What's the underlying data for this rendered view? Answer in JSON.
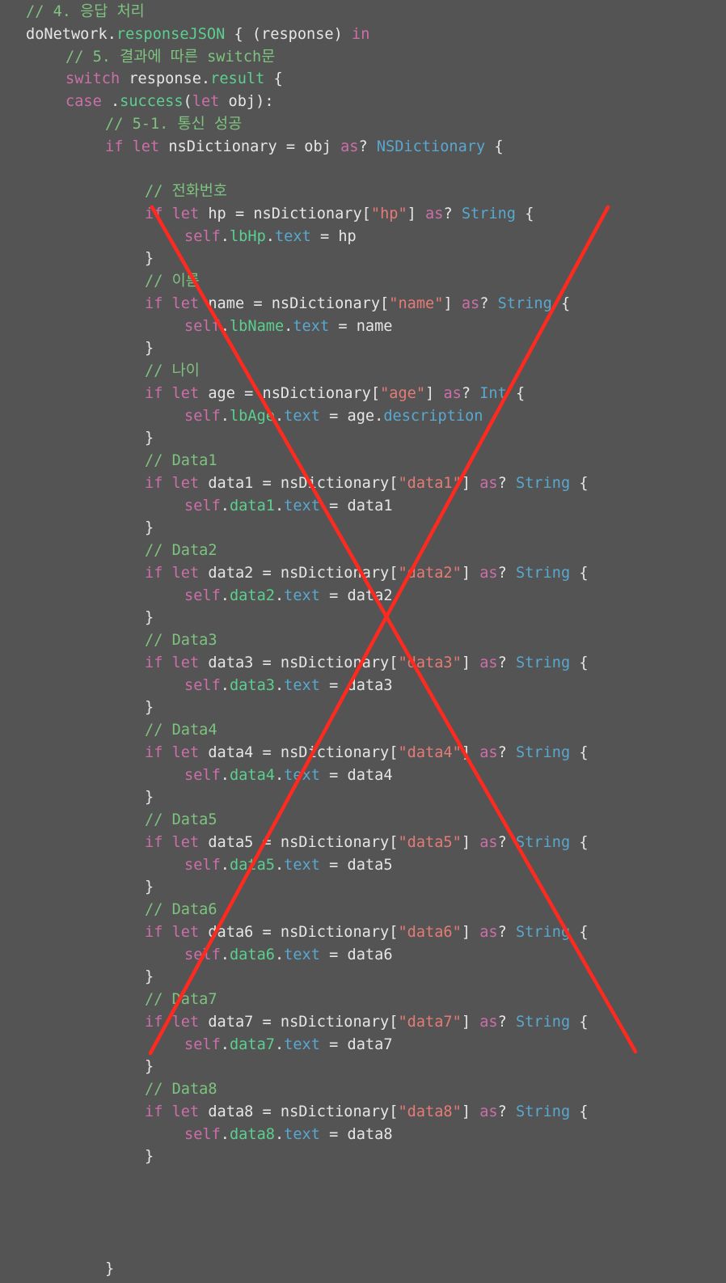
{
  "theme": {
    "background": "#545454",
    "plain": "#e6e6e6",
    "comment": "#7ec37f",
    "keyword": "#cc6fa9",
    "string": "#e57b76",
    "type": "#58a8d0",
    "member": "#5ccf8f",
    "property": "#58a8d0",
    "cross": "#ff2a1f"
  },
  "code": {
    "lines": [
      {
        "i": 0,
        "t": [
          [
            "comment",
            "// 4. 응답 처리"
          ]
        ]
      },
      {
        "i": 0,
        "t": [
          [
            "plain",
            "doNetwork."
          ],
          [
            "member",
            "responseJSON"
          ],
          [
            "plain",
            " { (response) "
          ],
          [
            "keyword",
            "in"
          ]
        ]
      },
      {
        "i": 1,
        "t": [
          [
            "comment",
            "// 5. 결과에 따른 switch문"
          ]
        ]
      },
      {
        "i": 1,
        "t": [
          [
            "keyword",
            "switch"
          ],
          [
            "plain",
            " response."
          ],
          [
            "member",
            "result"
          ],
          [
            "plain",
            " {"
          ]
        ]
      },
      {
        "i": 1,
        "t": [
          [
            "keyword",
            "case"
          ],
          [
            "plain",
            " ."
          ],
          [
            "member",
            "success"
          ],
          [
            "plain",
            "("
          ],
          [
            "keyword",
            "let"
          ],
          [
            "plain",
            " obj):"
          ]
        ]
      },
      {
        "i": 2,
        "t": [
          [
            "comment",
            "// 5-1. 통신 성공"
          ]
        ]
      },
      {
        "i": 2,
        "t": [
          [
            "keyword",
            "if let"
          ],
          [
            "plain",
            " nsDictionary = obj "
          ],
          [
            "keyword",
            "as"
          ],
          [
            "plain",
            "? "
          ],
          [
            "type",
            "NSDictionary"
          ],
          [
            "plain",
            " {"
          ]
        ]
      },
      {
        "i": 0,
        "t": []
      },
      {
        "i": 3,
        "t": [
          [
            "comment",
            "// 전화번호"
          ]
        ]
      },
      {
        "i": 3,
        "t": [
          [
            "keyword",
            "if let"
          ],
          [
            "plain",
            " hp = nsDictionary["
          ],
          [
            "string",
            "\"hp\""
          ],
          [
            "plain",
            "] "
          ],
          [
            "keyword",
            "as"
          ],
          [
            "plain",
            "? "
          ],
          [
            "type",
            "String"
          ],
          [
            "plain",
            " {"
          ]
        ]
      },
      {
        "i": 4,
        "t": [
          [
            "keyword",
            "self"
          ],
          [
            "plain",
            "."
          ],
          [
            "member",
            "lbHp"
          ],
          [
            "plain",
            "."
          ],
          [
            "prop",
            "text"
          ],
          [
            "plain",
            " = hp"
          ]
        ]
      },
      {
        "i": 3,
        "t": [
          [
            "plain",
            "}"
          ]
        ]
      },
      {
        "i": 3,
        "t": [
          [
            "comment",
            "// 이름"
          ]
        ]
      },
      {
        "i": 3,
        "t": [
          [
            "keyword",
            "if let"
          ],
          [
            "plain",
            " name = nsDictionary["
          ],
          [
            "string",
            "\"name\""
          ],
          [
            "plain",
            "] "
          ],
          [
            "keyword",
            "as"
          ],
          [
            "plain",
            "? "
          ],
          [
            "type",
            "String"
          ],
          [
            "plain",
            " {"
          ]
        ]
      },
      {
        "i": 4,
        "t": [
          [
            "keyword",
            "self"
          ],
          [
            "plain",
            "."
          ],
          [
            "member",
            "lbName"
          ],
          [
            "plain",
            "."
          ],
          [
            "prop",
            "text"
          ],
          [
            "plain",
            " = name"
          ]
        ]
      },
      {
        "i": 3,
        "t": [
          [
            "plain",
            "}"
          ]
        ]
      },
      {
        "i": 3,
        "t": [
          [
            "comment",
            "// 나이"
          ]
        ]
      },
      {
        "i": 3,
        "t": [
          [
            "keyword",
            "if let"
          ],
          [
            "plain",
            " age = nsDictionary["
          ],
          [
            "string",
            "\"age\""
          ],
          [
            "plain",
            "] "
          ],
          [
            "keyword",
            "as"
          ],
          [
            "plain",
            "? "
          ],
          [
            "type",
            "Int"
          ],
          [
            "plain",
            " {"
          ]
        ]
      },
      {
        "i": 4,
        "t": [
          [
            "keyword",
            "self"
          ],
          [
            "plain",
            "."
          ],
          [
            "member",
            "lbAge"
          ],
          [
            "plain",
            "."
          ],
          [
            "prop",
            "text"
          ],
          [
            "plain",
            " = age."
          ],
          [
            "prop",
            "description"
          ]
        ]
      },
      {
        "i": 3,
        "t": [
          [
            "plain",
            "}"
          ]
        ]
      },
      {
        "i": 3,
        "t": [
          [
            "comment",
            "// Data1"
          ]
        ]
      },
      {
        "i": 3,
        "t": [
          [
            "keyword",
            "if let"
          ],
          [
            "plain",
            " data1 = nsDictionary["
          ],
          [
            "string",
            "\"data1\""
          ],
          [
            "plain",
            "] "
          ],
          [
            "keyword",
            "as"
          ],
          [
            "plain",
            "? "
          ],
          [
            "type",
            "String"
          ],
          [
            "plain",
            " {"
          ]
        ]
      },
      {
        "i": 4,
        "t": [
          [
            "keyword",
            "self"
          ],
          [
            "plain",
            "."
          ],
          [
            "member",
            "data1"
          ],
          [
            "plain",
            "."
          ],
          [
            "prop",
            "text"
          ],
          [
            "plain",
            " = data1"
          ]
        ]
      },
      {
        "i": 3,
        "t": [
          [
            "plain",
            "}"
          ]
        ]
      },
      {
        "i": 3,
        "t": [
          [
            "comment",
            "// Data2"
          ]
        ]
      },
      {
        "i": 3,
        "t": [
          [
            "keyword",
            "if let"
          ],
          [
            "plain",
            " data2 = nsDictionary["
          ],
          [
            "string",
            "\"data2\""
          ],
          [
            "plain",
            "] "
          ],
          [
            "keyword",
            "as"
          ],
          [
            "plain",
            "? "
          ],
          [
            "type",
            "String"
          ],
          [
            "plain",
            " {"
          ]
        ]
      },
      {
        "i": 4,
        "t": [
          [
            "keyword",
            "self"
          ],
          [
            "plain",
            "."
          ],
          [
            "member",
            "data2"
          ],
          [
            "plain",
            "."
          ],
          [
            "prop",
            "text"
          ],
          [
            "plain",
            " = data2"
          ]
        ]
      },
      {
        "i": 3,
        "t": [
          [
            "plain",
            "}"
          ]
        ]
      },
      {
        "i": 3,
        "t": [
          [
            "comment",
            "// Data3"
          ]
        ]
      },
      {
        "i": 3,
        "t": [
          [
            "keyword",
            "if let"
          ],
          [
            "plain",
            " data3 = nsDictionary["
          ],
          [
            "string",
            "\"data3\""
          ],
          [
            "plain",
            "] "
          ],
          [
            "keyword",
            "as"
          ],
          [
            "plain",
            "? "
          ],
          [
            "type",
            "String"
          ],
          [
            "plain",
            " {"
          ]
        ]
      },
      {
        "i": 4,
        "t": [
          [
            "keyword",
            "self"
          ],
          [
            "plain",
            "."
          ],
          [
            "member",
            "data3"
          ],
          [
            "plain",
            "."
          ],
          [
            "prop",
            "text"
          ],
          [
            "plain",
            " = data3"
          ]
        ]
      },
      {
        "i": 3,
        "t": [
          [
            "plain",
            "}"
          ]
        ]
      },
      {
        "i": 3,
        "t": [
          [
            "comment",
            "// Data4"
          ]
        ]
      },
      {
        "i": 3,
        "t": [
          [
            "keyword",
            "if let"
          ],
          [
            "plain",
            " data4 = nsDictionary["
          ],
          [
            "string",
            "\"data4\""
          ],
          [
            "plain",
            "] "
          ],
          [
            "keyword",
            "as"
          ],
          [
            "plain",
            "? "
          ],
          [
            "type",
            "String"
          ],
          [
            "plain",
            " {"
          ]
        ]
      },
      {
        "i": 4,
        "t": [
          [
            "keyword",
            "self"
          ],
          [
            "plain",
            "."
          ],
          [
            "member",
            "data4"
          ],
          [
            "plain",
            "."
          ],
          [
            "prop",
            "text"
          ],
          [
            "plain",
            " = data4"
          ]
        ]
      },
      {
        "i": 3,
        "t": [
          [
            "plain",
            "}"
          ]
        ]
      },
      {
        "i": 3,
        "t": [
          [
            "comment",
            "// Data5"
          ]
        ]
      },
      {
        "i": 3,
        "t": [
          [
            "keyword",
            "if let"
          ],
          [
            "plain",
            " data5 = nsDictionary["
          ],
          [
            "string",
            "\"data5\""
          ],
          [
            "plain",
            "] "
          ],
          [
            "keyword",
            "as"
          ],
          [
            "plain",
            "? "
          ],
          [
            "type",
            "String"
          ],
          [
            "plain",
            " {"
          ]
        ]
      },
      {
        "i": 4,
        "t": [
          [
            "keyword",
            "self"
          ],
          [
            "plain",
            "."
          ],
          [
            "member",
            "data5"
          ],
          [
            "plain",
            "."
          ],
          [
            "prop",
            "text"
          ],
          [
            "plain",
            " = data5"
          ]
        ]
      },
      {
        "i": 3,
        "t": [
          [
            "plain",
            "}"
          ]
        ]
      },
      {
        "i": 3,
        "t": [
          [
            "comment",
            "// Data6"
          ]
        ]
      },
      {
        "i": 3,
        "t": [
          [
            "keyword",
            "if let"
          ],
          [
            "plain",
            " data6 = nsDictionary["
          ],
          [
            "string",
            "\"data6\""
          ],
          [
            "plain",
            "] "
          ],
          [
            "keyword",
            "as"
          ],
          [
            "plain",
            "? "
          ],
          [
            "type",
            "String"
          ],
          [
            "plain",
            " {"
          ]
        ]
      },
      {
        "i": 4,
        "t": [
          [
            "keyword",
            "self"
          ],
          [
            "plain",
            "."
          ],
          [
            "member",
            "data6"
          ],
          [
            "plain",
            "."
          ],
          [
            "prop",
            "text"
          ],
          [
            "plain",
            " = data6"
          ]
        ]
      },
      {
        "i": 3,
        "t": [
          [
            "plain",
            "}"
          ]
        ]
      },
      {
        "i": 3,
        "t": [
          [
            "comment",
            "// Data7"
          ]
        ]
      },
      {
        "i": 3,
        "t": [
          [
            "keyword",
            "if let"
          ],
          [
            "plain",
            " data7 = nsDictionary["
          ],
          [
            "string",
            "\"data7\""
          ],
          [
            "plain",
            "] "
          ],
          [
            "keyword",
            "as"
          ],
          [
            "plain",
            "? "
          ],
          [
            "type",
            "String"
          ],
          [
            "plain",
            " {"
          ]
        ]
      },
      {
        "i": 4,
        "t": [
          [
            "keyword",
            "self"
          ],
          [
            "plain",
            "."
          ],
          [
            "member",
            "data7"
          ],
          [
            "plain",
            "."
          ],
          [
            "prop",
            "text"
          ],
          [
            "plain",
            " = data7"
          ]
        ]
      },
      {
        "i": 3,
        "t": [
          [
            "plain",
            "}"
          ]
        ]
      },
      {
        "i": 3,
        "t": [
          [
            "comment",
            "// Data8"
          ]
        ]
      },
      {
        "i": 3,
        "t": [
          [
            "keyword",
            "if let"
          ],
          [
            "plain",
            " data8 = nsDictionary["
          ],
          [
            "string",
            "\"data8\""
          ],
          [
            "plain",
            "] "
          ],
          [
            "keyword",
            "as"
          ],
          [
            "plain",
            "? "
          ],
          [
            "type",
            "String"
          ],
          [
            "plain",
            " {"
          ]
        ]
      },
      {
        "i": 4,
        "t": [
          [
            "keyword",
            "self"
          ],
          [
            "plain",
            "."
          ],
          [
            "member",
            "data8"
          ],
          [
            "plain",
            "."
          ],
          [
            "prop",
            "text"
          ],
          [
            "plain",
            " = data8"
          ]
        ]
      },
      {
        "i": 3,
        "t": [
          [
            "plain",
            "}"
          ]
        ]
      },
      {
        "i": 0,
        "t": []
      },
      {
        "i": 0,
        "t": []
      },
      {
        "i": 0,
        "t": []
      },
      {
        "i": 0,
        "t": []
      },
      {
        "i": 2,
        "t": [
          [
            "plain",
            "}"
          ]
        ]
      }
    ]
  }
}
